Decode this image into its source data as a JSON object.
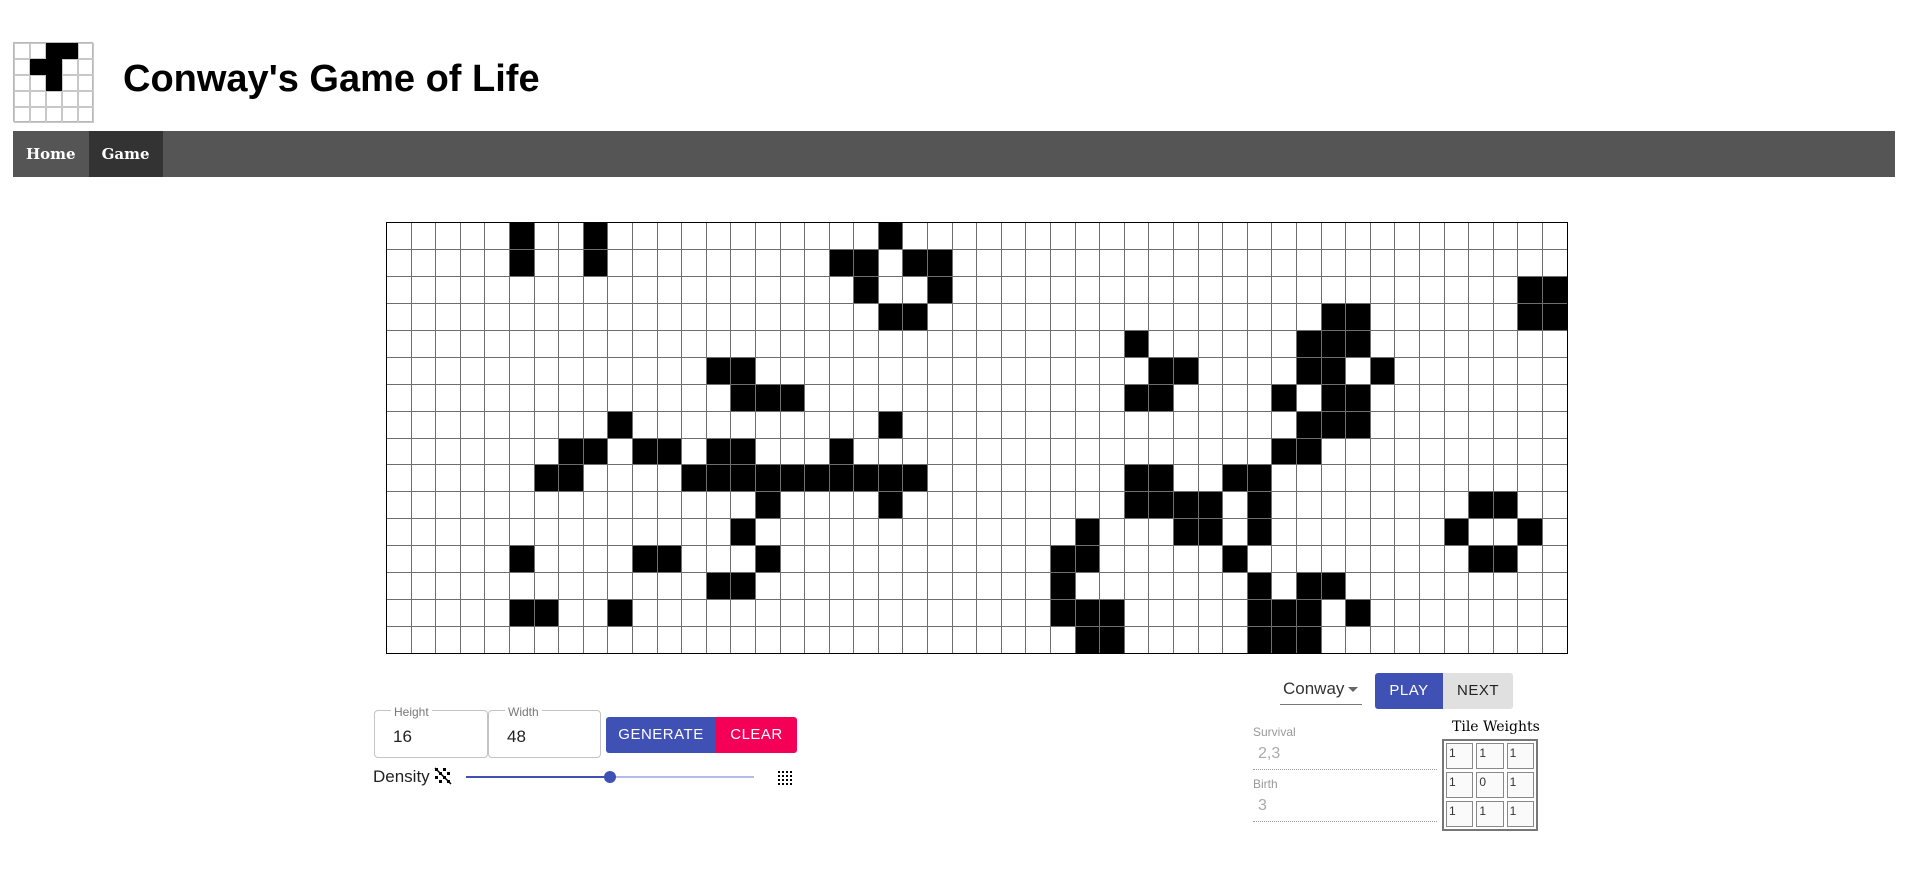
{
  "header": {
    "title": "Conway's Game of Life",
    "logo_cells_alive": [
      [
        0,
        2
      ],
      [
        0,
        3
      ],
      [
        1,
        1
      ],
      [
        1,
        2
      ],
      [
        2,
        2
      ]
    ]
  },
  "nav": {
    "items": [
      {
        "label": "Home",
        "active": false
      },
      {
        "label": "Game",
        "active": true
      }
    ]
  },
  "board": {
    "rows": 16,
    "cols": 48,
    "alive": [
      [
        0,
        5
      ],
      [
        0,
        8
      ],
      [
        0,
        20
      ],
      [
        1,
        5
      ],
      [
        1,
        8
      ],
      [
        1,
        18
      ],
      [
        1,
        19
      ],
      [
        1,
        21
      ],
      [
        1,
        22
      ],
      [
        2,
        19
      ],
      [
        2,
        22
      ],
      [
        2,
        46
      ],
      [
        2,
        47
      ],
      [
        3,
        20
      ],
      [
        3,
        21
      ],
      [
        3,
        38
      ],
      [
        3,
        39
      ],
      [
        3,
        46
      ],
      [
        3,
        47
      ],
      [
        4,
        30
      ],
      [
        4,
        37
      ],
      [
        4,
        38
      ],
      [
        4,
        39
      ],
      [
        5,
        13
      ],
      [
        5,
        14
      ],
      [
        5,
        31
      ],
      [
        5,
        32
      ],
      [
        5,
        37
      ],
      [
        5,
        38
      ],
      [
        5,
        40
      ],
      [
        6,
        14
      ],
      [
        6,
        15
      ],
      [
        6,
        16
      ],
      [
        6,
        30
      ],
      [
        6,
        31
      ],
      [
        6,
        36
      ],
      [
        6,
        38
      ],
      [
        6,
        39
      ],
      [
        7,
        9
      ],
      [
        7,
        20
      ],
      [
        7,
        37
      ],
      [
        7,
        38
      ],
      [
        7,
        39
      ],
      [
        8,
        7
      ],
      [
        8,
        8
      ],
      [
        8,
        10
      ],
      [
        8,
        11
      ],
      [
        8,
        13
      ],
      [
        8,
        14
      ],
      [
        8,
        18
      ],
      [
        8,
        36
      ],
      [
        8,
        37
      ],
      [
        9,
        6
      ],
      [
        9,
        7
      ],
      [
        9,
        12
      ],
      [
        9,
        13
      ],
      [
        9,
        14
      ],
      [
        9,
        15
      ],
      [
        9,
        16
      ],
      [
        9,
        17
      ],
      [
        9,
        18
      ],
      [
        9,
        19
      ],
      [
        9,
        20
      ],
      [
        9,
        21
      ],
      [
        9,
        30
      ],
      [
        9,
        31
      ],
      [
        9,
        34
      ],
      [
        9,
        35
      ],
      [
        10,
        15
      ],
      [
        10,
        20
      ],
      [
        10,
        30
      ],
      [
        10,
        31
      ],
      [
        10,
        32
      ],
      [
        10,
        33
      ],
      [
        10,
        35
      ],
      [
        10,
        44
      ],
      [
        10,
        45
      ],
      [
        11,
        14
      ],
      [
        11,
        28
      ],
      [
        11,
        32
      ],
      [
        11,
        33
      ],
      [
        11,
        35
      ],
      [
        11,
        43
      ],
      [
        11,
        46
      ],
      [
        12,
        5
      ],
      [
        12,
        10
      ],
      [
        12,
        11
      ],
      [
        12,
        15
      ],
      [
        12,
        27
      ],
      [
        12,
        28
      ],
      [
        12,
        34
      ],
      [
        12,
        44
      ],
      [
        12,
        45
      ],
      [
        13,
        13
      ],
      [
        13,
        14
      ],
      [
        13,
        27
      ],
      [
        13,
        35
      ],
      [
        13,
        37
      ],
      [
        13,
        38
      ],
      [
        14,
        5
      ],
      [
        14,
        6
      ],
      [
        14,
        9
      ],
      [
        14,
        27
      ],
      [
        14,
        28
      ],
      [
        14,
        29
      ],
      [
        14,
        35
      ],
      [
        14,
        36
      ],
      [
        14,
        37
      ],
      [
        14,
        39
      ],
      [
        15,
        28
      ],
      [
        15,
        29
      ],
      [
        15,
        35
      ],
      [
        15,
        36
      ],
      [
        15,
        37
      ]
    ]
  },
  "size": {
    "height_label": "Height",
    "height_value": "16",
    "width_label": "Width",
    "width_value": "48"
  },
  "buttons": {
    "generate": "GENERATE",
    "clear": "CLEAR",
    "play": "PLAY",
    "next": "NEXT"
  },
  "density": {
    "label": "Density",
    "value": 0.5
  },
  "rules": {
    "selected": "Conway",
    "survival_label": "Survival",
    "survival_value": "2,3",
    "birth_label": "Birth",
    "birth_value": "3"
  },
  "weights": {
    "title": "Tile Weights",
    "values": [
      "1",
      "1",
      "1",
      "1",
      "0",
      "1",
      "1",
      "1",
      "1"
    ]
  },
  "colors": {
    "primary": "#3f51b5",
    "accent": "#f50057",
    "nav_bg": "#555555",
    "nav_active": "#333333"
  }
}
